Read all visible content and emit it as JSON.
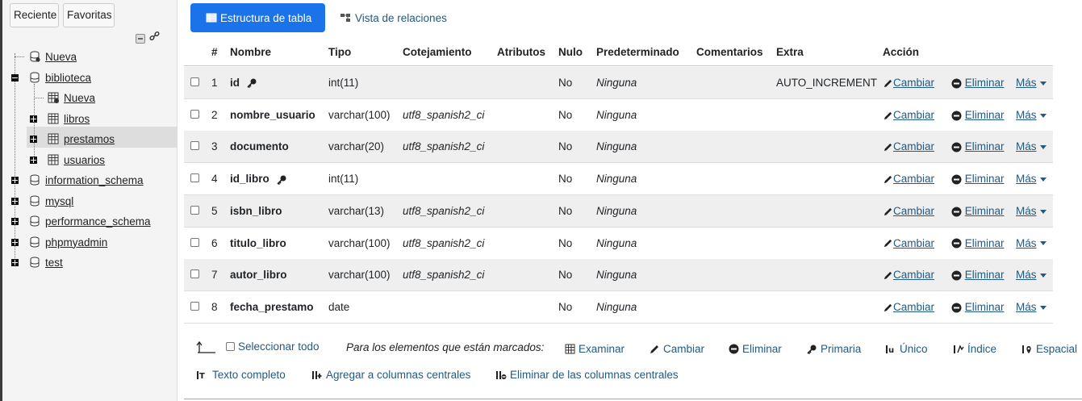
{
  "sidebar": {
    "tabs": [
      "Reciente",
      "Favoritas"
    ],
    "tree": [
      {
        "label": "Nueva",
        "kind": "db-new"
      },
      {
        "label": "biblioteca",
        "kind": "db",
        "expanded": true
      },
      {
        "label": "Nueva",
        "kind": "table-new"
      },
      {
        "label": "libros",
        "kind": "table"
      },
      {
        "label": "prestamos",
        "kind": "table",
        "selected": true
      },
      {
        "label": "usuarios",
        "kind": "table"
      },
      {
        "label": "information_schema",
        "kind": "db"
      },
      {
        "label": "mysql",
        "kind": "db"
      },
      {
        "label": "performance_schema",
        "kind": "db"
      },
      {
        "label": "phpmyadmin",
        "kind": "db"
      },
      {
        "label": "test",
        "kind": "db"
      }
    ]
  },
  "toolbar": {
    "structure_label": "Estructura de tabla",
    "relations_label": "Vista de relaciones"
  },
  "table": {
    "headers": [
      "#",
      "Nombre",
      "Tipo",
      "Cotejamiento",
      "Atributos",
      "Nulo",
      "Predeterminado",
      "Comentarios",
      "Extra",
      "Acción"
    ],
    "rows": [
      {
        "num": "1",
        "name": "id",
        "type": "int(11)",
        "collation": "",
        "null": "No",
        "default": "Ninguna",
        "extra": "AUTO_INCREMENT",
        "key": "primary"
      },
      {
        "num": "2",
        "name": "nombre_usuario",
        "type": "varchar(100)",
        "collation": "utf8_spanish2_ci",
        "null": "No",
        "default": "Ninguna",
        "extra": ""
      },
      {
        "num": "3",
        "name": "documento",
        "type": "varchar(20)",
        "collation": "utf8_spanish2_ci",
        "null": "No",
        "default": "Ninguna",
        "extra": ""
      },
      {
        "num": "4",
        "name": "id_libro",
        "type": "int(11)",
        "collation": "",
        "null": "No",
        "default": "Ninguna",
        "extra": "",
        "key": "index"
      },
      {
        "num": "5",
        "name": "isbn_libro",
        "type": "varchar(13)",
        "collation": "utf8_spanish2_ci",
        "null": "No",
        "default": "Ninguna",
        "extra": ""
      },
      {
        "num": "6",
        "name": "titulo_libro",
        "type": "varchar(100)",
        "collation": "utf8_spanish2_ci",
        "null": "No",
        "default": "Ninguna",
        "extra": ""
      },
      {
        "num": "7",
        "name": "autor_libro",
        "type": "varchar(100)",
        "collation": "utf8_spanish2_ci",
        "null": "No",
        "default": "Ninguna",
        "extra": ""
      },
      {
        "num": "8",
        "name": "fecha_prestamo",
        "type": "date",
        "collation": "",
        "null": "No",
        "default": "Ninguna",
        "extra": ""
      }
    ],
    "actions": {
      "change": "Cambiar",
      "delete": "Eliminar",
      "more": "Más"
    }
  },
  "footer": {
    "select_all": "Seleccionar todo",
    "with_selected": "Para los elementos que están marcados:",
    "browse": "Examinar",
    "change": "Cambiar",
    "delete": "Eliminar",
    "primary": "Primaria",
    "unique": "Único",
    "index": "Índice",
    "spatial": "Espacial",
    "fulltext": "Texto completo",
    "add_central": "Agregar a columnas centrales",
    "remove_central": "Eliminar de las columnas centrales"
  },
  "colors": {
    "accent": "#1a73e8",
    "link": "#235a81",
    "alt_row": "#efefef"
  }
}
